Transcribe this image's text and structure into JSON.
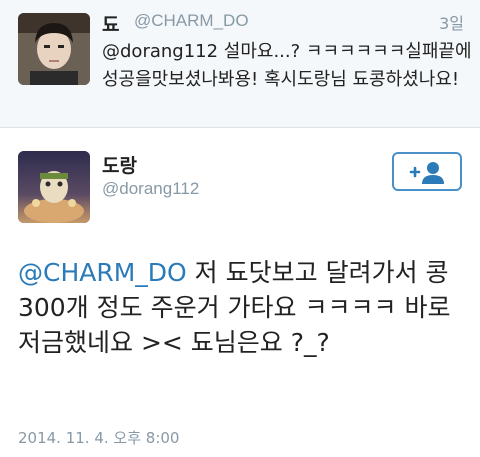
{
  "reply": {
    "name": "됴",
    "handle": "@CHARM_DO",
    "time": "3일",
    "text": "@dorang112 설마요...? ㅋㅋㅋㅋㅋㅋ실패끝에성공을맛보셨나봐용! 혹시도랑님 됴콩하셨나요!"
  },
  "main": {
    "name": "도랑",
    "handle": "@dorang112",
    "mention": "@CHARM_DO",
    "text": " 저 됴닷보고 달려가서 콩 300개 정도 주운거 가타요 ㅋㅋㅋㅋ 바로 저금했네요 >< 됴님은요 ?_?",
    "date": "2014. 11. 4. 오후 8:00"
  },
  "icons": {
    "follow": "add-user-icon"
  },
  "colors": {
    "accent": "#2b7bb9",
    "follow_border": "#4a90c8",
    "muted": "#8899a6",
    "reply_bg": "#f5f8fa"
  }
}
